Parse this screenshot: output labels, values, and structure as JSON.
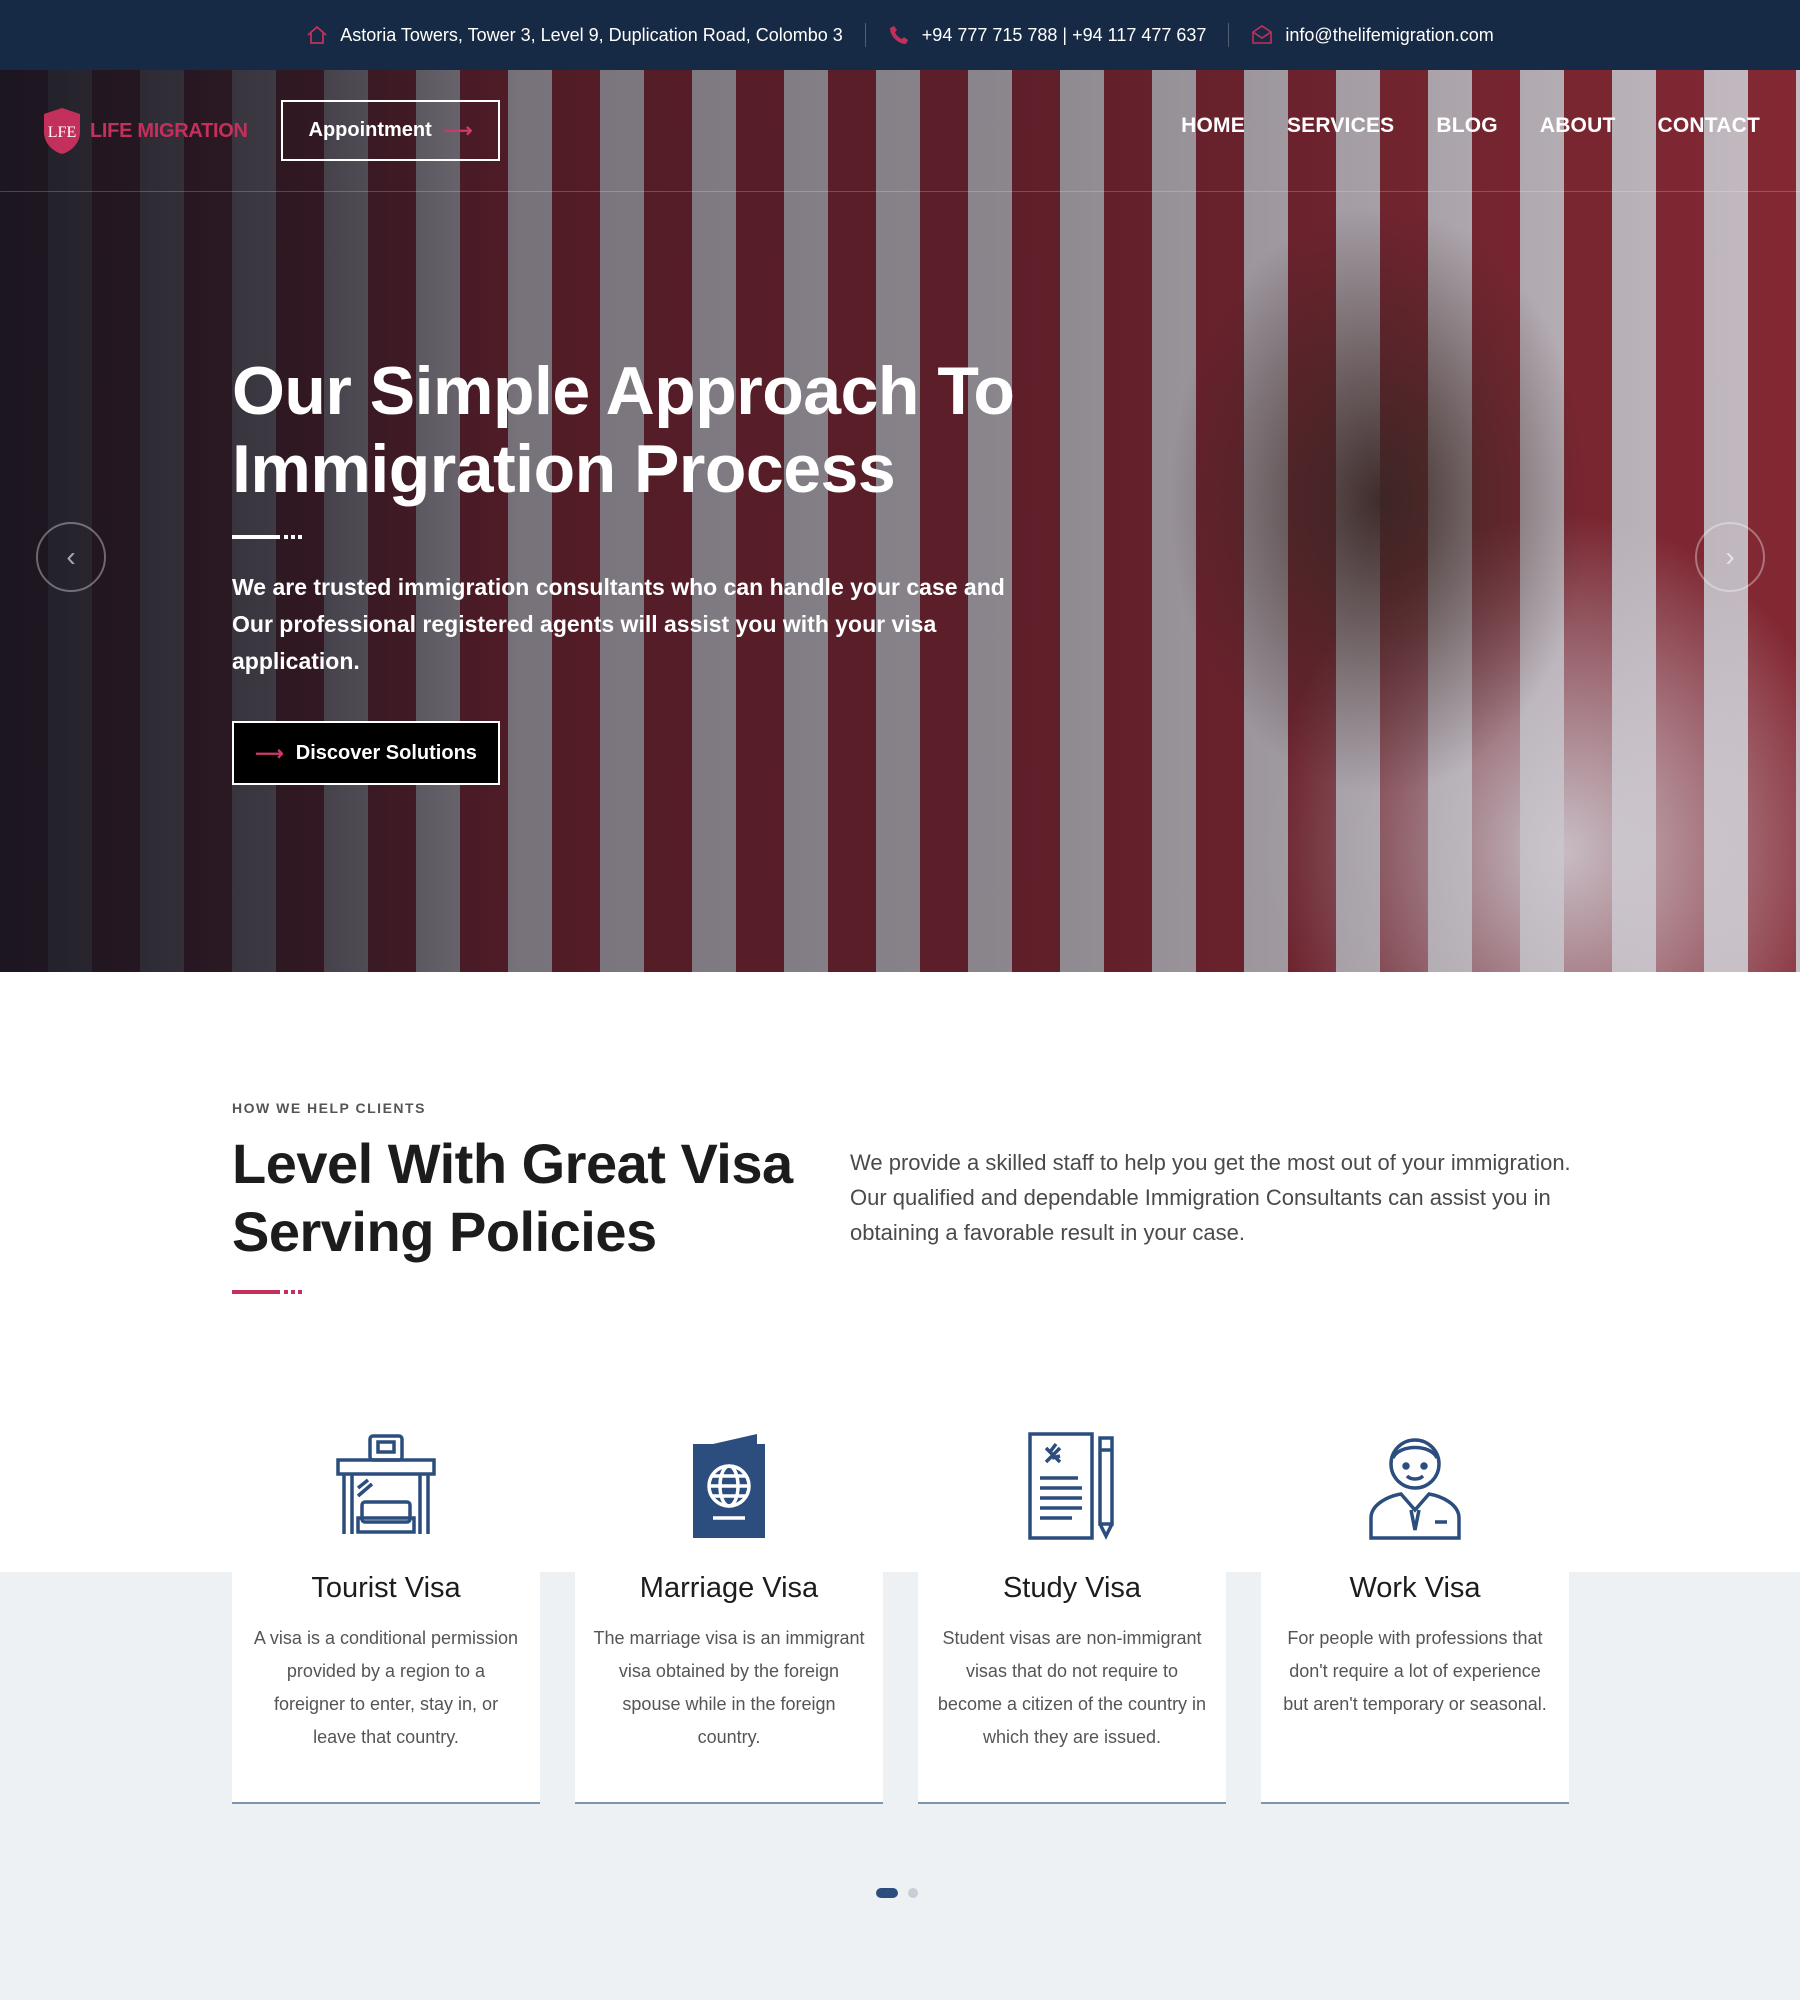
{
  "topbar": {
    "address": "Astoria Towers, Tower 3, Level 9, Duplication Road, Colombo 3",
    "phone": "+94 777 715 788 | +94 117 477 637",
    "email": "info@thelifemigration.com"
  },
  "brand": {
    "name": "LIFE MIGRATION",
    "accent": "#c3305b"
  },
  "nav": {
    "appointment_label": "Appointment",
    "links": [
      "HOME",
      "SERVICES",
      "BLOG",
      "ABOUT",
      "CONTACT"
    ]
  },
  "hero": {
    "title": "Our Simple Approach To Immigration Process",
    "description": "We are trusted immigration consultants who can handle your case and Our professional registered agents will assist you with your visa application.",
    "button_label": "Discover Solutions"
  },
  "section": {
    "eyebrow": "HOW WE HELP CLIENTS",
    "title": "Level With Great Visa Serving Policies",
    "description": "We provide a skilled staff to help you get the most out of your immigration. Our qualified and dependable Immigration Consultants can assist you in obtaining a favorable result in your case."
  },
  "cards": [
    {
      "title": "Tourist Visa",
      "text": "A visa is a conditional permission provided by a region to a foreigner to enter, stay in, or leave that country.",
      "icon": "tourist-icon"
    },
    {
      "title": "Marriage Visa",
      "text": "The marriage visa is an immigrant visa obtained by the foreign spouse while in the foreign country.",
      "icon": "passport-icon"
    },
    {
      "title": "Study Visa",
      "text": "Student visas are non-immigrant visas that do not require to become a citizen of the country in which they are issued.",
      "icon": "document-icon"
    },
    {
      "title": "Work Visa",
      "text": "For people with professions that don't require a lot of experience but aren't temporary or seasonal.",
      "icon": "worker-icon"
    }
  ],
  "colors": {
    "topbar": "#172a45",
    "icon_blue": "#2b4e7e",
    "accent": "#d0386a"
  }
}
